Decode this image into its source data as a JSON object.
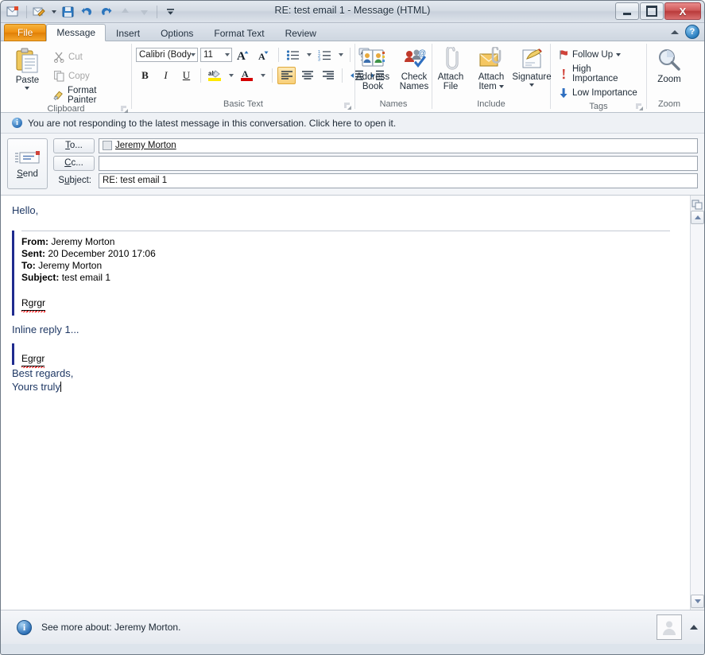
{
  "window": {
    "title": "RE: test email 1  -  Message (HTML)",
    "minimize_label": "Minimize",
    "maximize_label": "Maximize",
    "close_label": "X"
  },
  "quick_access": {
    "items": [
      {
        "name": "outlook-icon",
        "label": "Outlook"
      },
      {
        "name": "new-message-icon",
        "label": "New"
      },
      {
        "name": "save-icon",
        "label": "Save"
      },
      {
        "name": "undo-icon",
        "label": "Undo"
      },
      {
        "name": "redo-icon",
        "label": "Redo"
      },
      {
        "name": "previous-item-icon",
        "label": "Previous Item"
      },
      {
        "name": "next-item-icon",
        "label": "Next Item"
      },
      {
        "name": "customize-qat-icon",
        "label": "Customize Quick Access Toolbar"
      }
    ]
  },
  "tabs": [
    {
      "label": "File",
      "active": false,
      "file": true
    },
    {
      "label": "Message",
      "active": true
    },
    {
      "label": "Insert",
      "active": false
    },
    {
      "label": "Options",
      "active": false
    },
    {
      "label": "Format Text",
      "active": false
    },
    {
      "label": "Review",
      "active": false
    }
  ],
  "tab_right": {
    "collapse_ribbon_label": "Minimize the Ribbon",
    "help_label": "?"
  },
  "ribbon": {
    "clipboard": {
      "label": "Clipboard",
      "paste": "Paste",
      "cut": "Cut",
      "copy": "Copy",
      "format_painter": "Format Painter"
    },
    "basic_text": {
      "label": "Basic Text",
      "font_name": "Calibri (Body)",
      "font_size": "11",
      "grow_font": "A",
      "shrink_font": "A",
      "bold": "B",
      "italic": "I",
      "underline": "U",
      "bullets": "Bullets",
      "numbering": "Numbering",
      "clear_formatting": "Clear Formatting",
      "highlight": "ab",
      "font_color": "A",
      "align_left": "Align Text Left",
      "align_center": "Center",
      "align_right": "Align Text Right",
      "decrease_indent": "Decrease Indent",
      "increase_indent": "Increase Indent"
    },
    "names": {
      "label": "Names",
      "address_book_l1": "Address",
      "address_book_l2": "Book",
      "check_names_l1": "Check",
      "check_names_l2": "Names"
    },
    "include": {
      "label": "Include",
      "attach_file_l1": "Attach",
      "attach_file_l2": "File",
      "attach_item_l1": "Attach",
      "attach_item_l2": "Item",
      "signature": "Signature"
    },
    "tags": {
      "label": "Tags",
      "follow_up": "Follow Up",
      "high_importance": "High Importance",
      "low_importance": "Low Importance"
    },
    "zoom": {
      "label": "Zoom",
      "button": "Zoom"
    }
  },
  "infobar": {
    "icon": "i",
    "text": "You are not responding to the latest message in this conversation. Click here to open it."
  },
  "compose": {
    "send_label": "Send",
    "to_button": "To...",
    "cc_button": "Cc...",
    "subject_label": "Subject:",
    "to_value": "Jeremy Morton",
    "cc_value": "",
    "subject_value": "RE: test email 1"
  },
  "body": {
    "greeting": "Hello,",
    "quoted_header": {
      "from_label": "From:",
      "from_value": "Jeremy Morton",
      "sent_label": "Sent:",
      "sent_value": "20 December 2010 17:06",
      "to_label": "To:",
      "to_value": "Jeremy Morton",
      "subject_label": "Subject:",
      "subject_value": "test email 1"
    },
    "quoted_text_1": "Rgrgr",
    "inline_reply": "Inline reply 1...",
    "quoted_text_2": "Egrgr",
    "closing_1": "Best regards,",
    "closing_2": "Yours truly"
  },
  "statusbar": {
    "icon": "i",
    "text": "See more about: Jeremy Morton.",
    "photo_label": "Contact photo",
    "expand_label": "Expand"
  },
  "colors": {
    "accent_orange": "#ef8f10",
    "quote_blue": "#1f2b8f",
    "body_text_blue": "#1F3864",
    "spell_error_red": "#ee0000",
    "title_close_red": "#b93a3a"
  }
}
